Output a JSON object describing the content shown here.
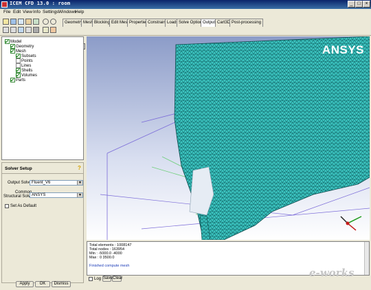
{
  "window": {
    "title": "ICEM CFD 13.0 : room"
  },
  "menu": [
    "File",
    "Edit",
    "View",
    "Info",
    "Settings",
    "Windows",
    "Help"
  ],
  "tabs": [
    "Geometry",
    "Mesh",
    "Blocking",
    "Edit Mesh",
    "Properties",
    "Constraints",
    "Loads",
    "Solve Options",
    "Output",
    "Cart3D",
    "Post-processing"
  ],
  "active_tab": "Output",
  "tree": [
    {
      "label": "Model",
      "level": 0,
      "checked": true
    },
    {
      "label": "Geometry",
      "level": 1,
      "checked": true
    },
    {
      "label": "Mesh",
      "level": 1,
      "checked": true
    },
    {
      "label": "Subsets",
      "level": 2,
      "checked": true
    },
    {
      "label": "Points",
      "level": 2,
      "checked": false
    },
    {
      "label": "Lines",
      "level": 2,
      "checked": false
    },
    {
      "label": "Shells",
      "level": 2,
      "checked": true
    },
    {
      "label": "Volumes",
      "level": 2,
      "checked": true
    },
    {
      "label": "Parts",
      "level": 1,
      "checked": true
    }
  ],
  "solver_setup": {
    "title": "Solver Setup",
    "output_solver_label": "Output Solver",
    "output_solver_value": "Fluent_V6",
    "structural_label_1": "Common",
    "structural_label_2": "Structural Solver",
    "structural_value": "ANSYS",
    "set_default_label": "Set As Default"
  },
  "dialog_buttons": {
    "apply": "Apply",
    "ok": "OK",
    "dismiss": "Dismiss"
  },
  "console": {
    "lines": [
      "Total elements : 1008147",
      "Total nodes : 163954",
      "Min : -5000.0 -4000",
      "Max : 0 3500.0",
      "",
      "Finished compute mesh"
    ],
    "log_label": "Log",
    "save_label": "Save",
    "clear_label": "Clear"
  },
  "brand": "ANSYS",
  "watermark": "e-works",
  "colors": {
    "mesh": "#3cc4c0",
    "mesh_edge": "#0c5a5c",
    "viewport_top": "#8c9cc8",
    "viewport_bottom": "#ffffff"
  }
}
